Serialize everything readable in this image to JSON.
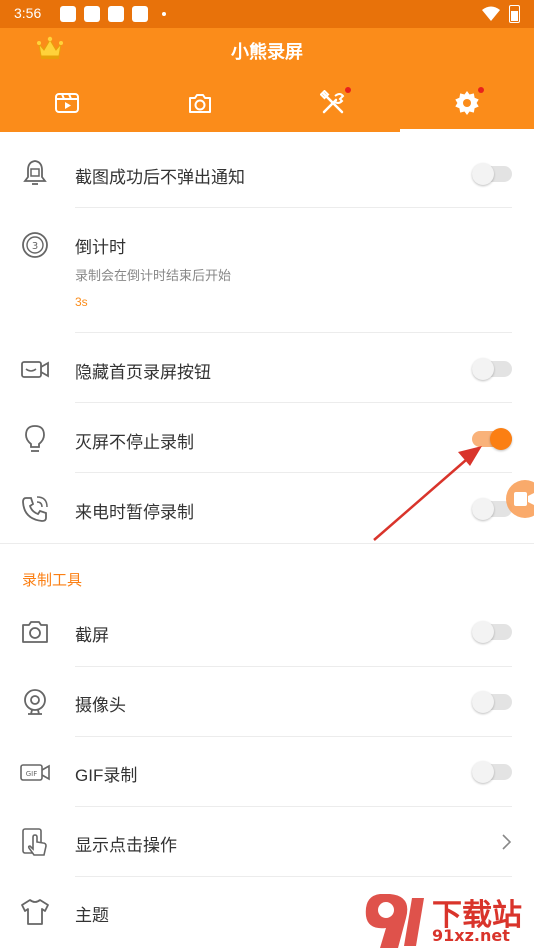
{
  "status_bar": {
    "time": "3:56"
  },
  "app": {
    "title": "小熊录屏"
  },
  "tabs": [
    {
      "name": "videos",
      "badge": false
    },
    {
      "name": "screenshots",
      "badge": false
    },
    {
      "name": "tools",
      "badge": true
    },
    {
      "name": "settings",
      "badge": true,
      "selected": true
    }
  ],
  "settings": {
    "no_popup": {
      "label": "截图成功后不弹出通知",
      "on": false
    },
    "countdown": {
      "label": "倒计时",
      "description": "录制会在倒计时结束后开始",
      "value": "3s"
    },
    "hide_button": {
      "label": "隐藏首页录屏按钮",
      "on": false
    },
    "screen_off": {
      "label": "灭屏不停止录制",
      "on": true
    },
    "pause_on_call": {
      "label": "来电时暂停录制",
      "on": false
    }
  },
  "recording_tools": {
    "section_title": "录制工具",
    "items": [
      {
        "label": "截屏",
        "on": false
      },
      {
        "label": "摄像头",
        "on": false
      },
      {
        "label": "GIF录制",
        "on": false
      },
      {
        "label": "显示点击操作"
      },
      {
        "label": "主题"
      }
    ]
  },
  "watermark": {
    "brand": "下载站",
    "url": "91xz.net"
  },
  "colors": {
    "accent": "#fb8c1a",
    "status_bar": "#e8720a",
    "toggle_on": "#fb7f13",
    "annotation_arrow": "#d9342b"
  }
}
